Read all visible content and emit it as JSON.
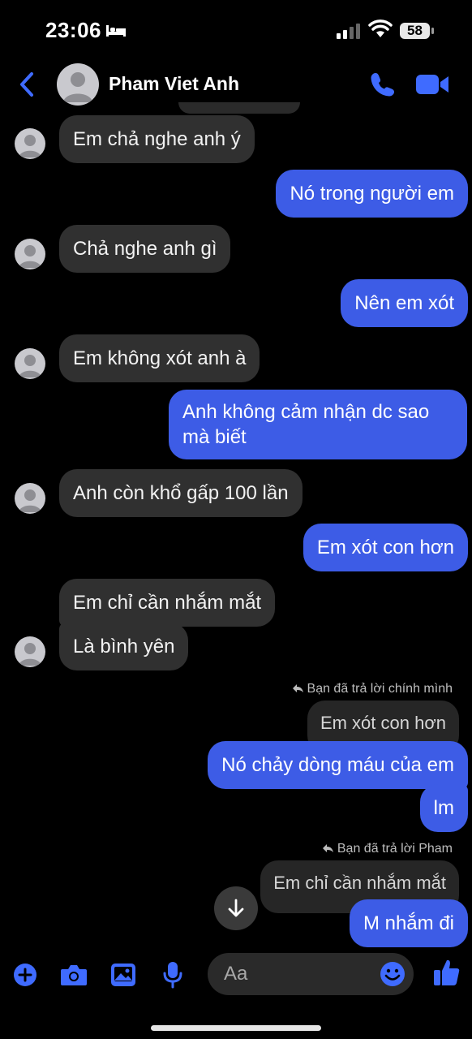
{
  "status_bar": {
    "time": "23:06",
    "battery": "58"
  },
  "header": {
    "contact_name": "Pham Viet Anh"
  },
  "messages": {
    "m1": "Em chả nghe anh ý",
    "m2": "Nó trong người em",
    "m3": "Chả nghe anh gì",
    "m4": "Nên em xót",
    "m5": "Em không xót anh à",
    "m6_line1": "Anh không cảm nhận dc sao",
    "m6_line2": "mà biết",
    "m7": "Anh còn khổ gấp 100 lần",
    "m8": "Em xót con hơn",
    "m9": "Em chỉ cần nhắm mắt",
    "m10": "Là bình yên",
    "reply_note_1": "Bạn đã trả lời chính mình",
    "quoted_1": "Em xót con hơn",
    "m11": "Nó chảy dòng máu của em",
    "m12": "lm",
    "reply_note_2": "Bạn đã trả lời Pham",
    "quoted_2": "Em chỉ cần nhắm mắt",
    "m13": "M nhắm đi"
  },
  "composer": {
    "placeholder": "Aa"
  },
  "colors": {
    "accent": "#3d5ce6",
    "incoming_bubble": "#303030",
    "background": "#000000"
  },
  "icons": [
    "back-icon",
    "phone-icon",
    "video-icon",
    "plus-icon",
    "camera-icon",
    "image-icon",
    "mic-icon",
    "emoji-icon",
    "thumbs-up-icon",
    "arrow-down-icon",
    "reply-icon"
  ]
}
